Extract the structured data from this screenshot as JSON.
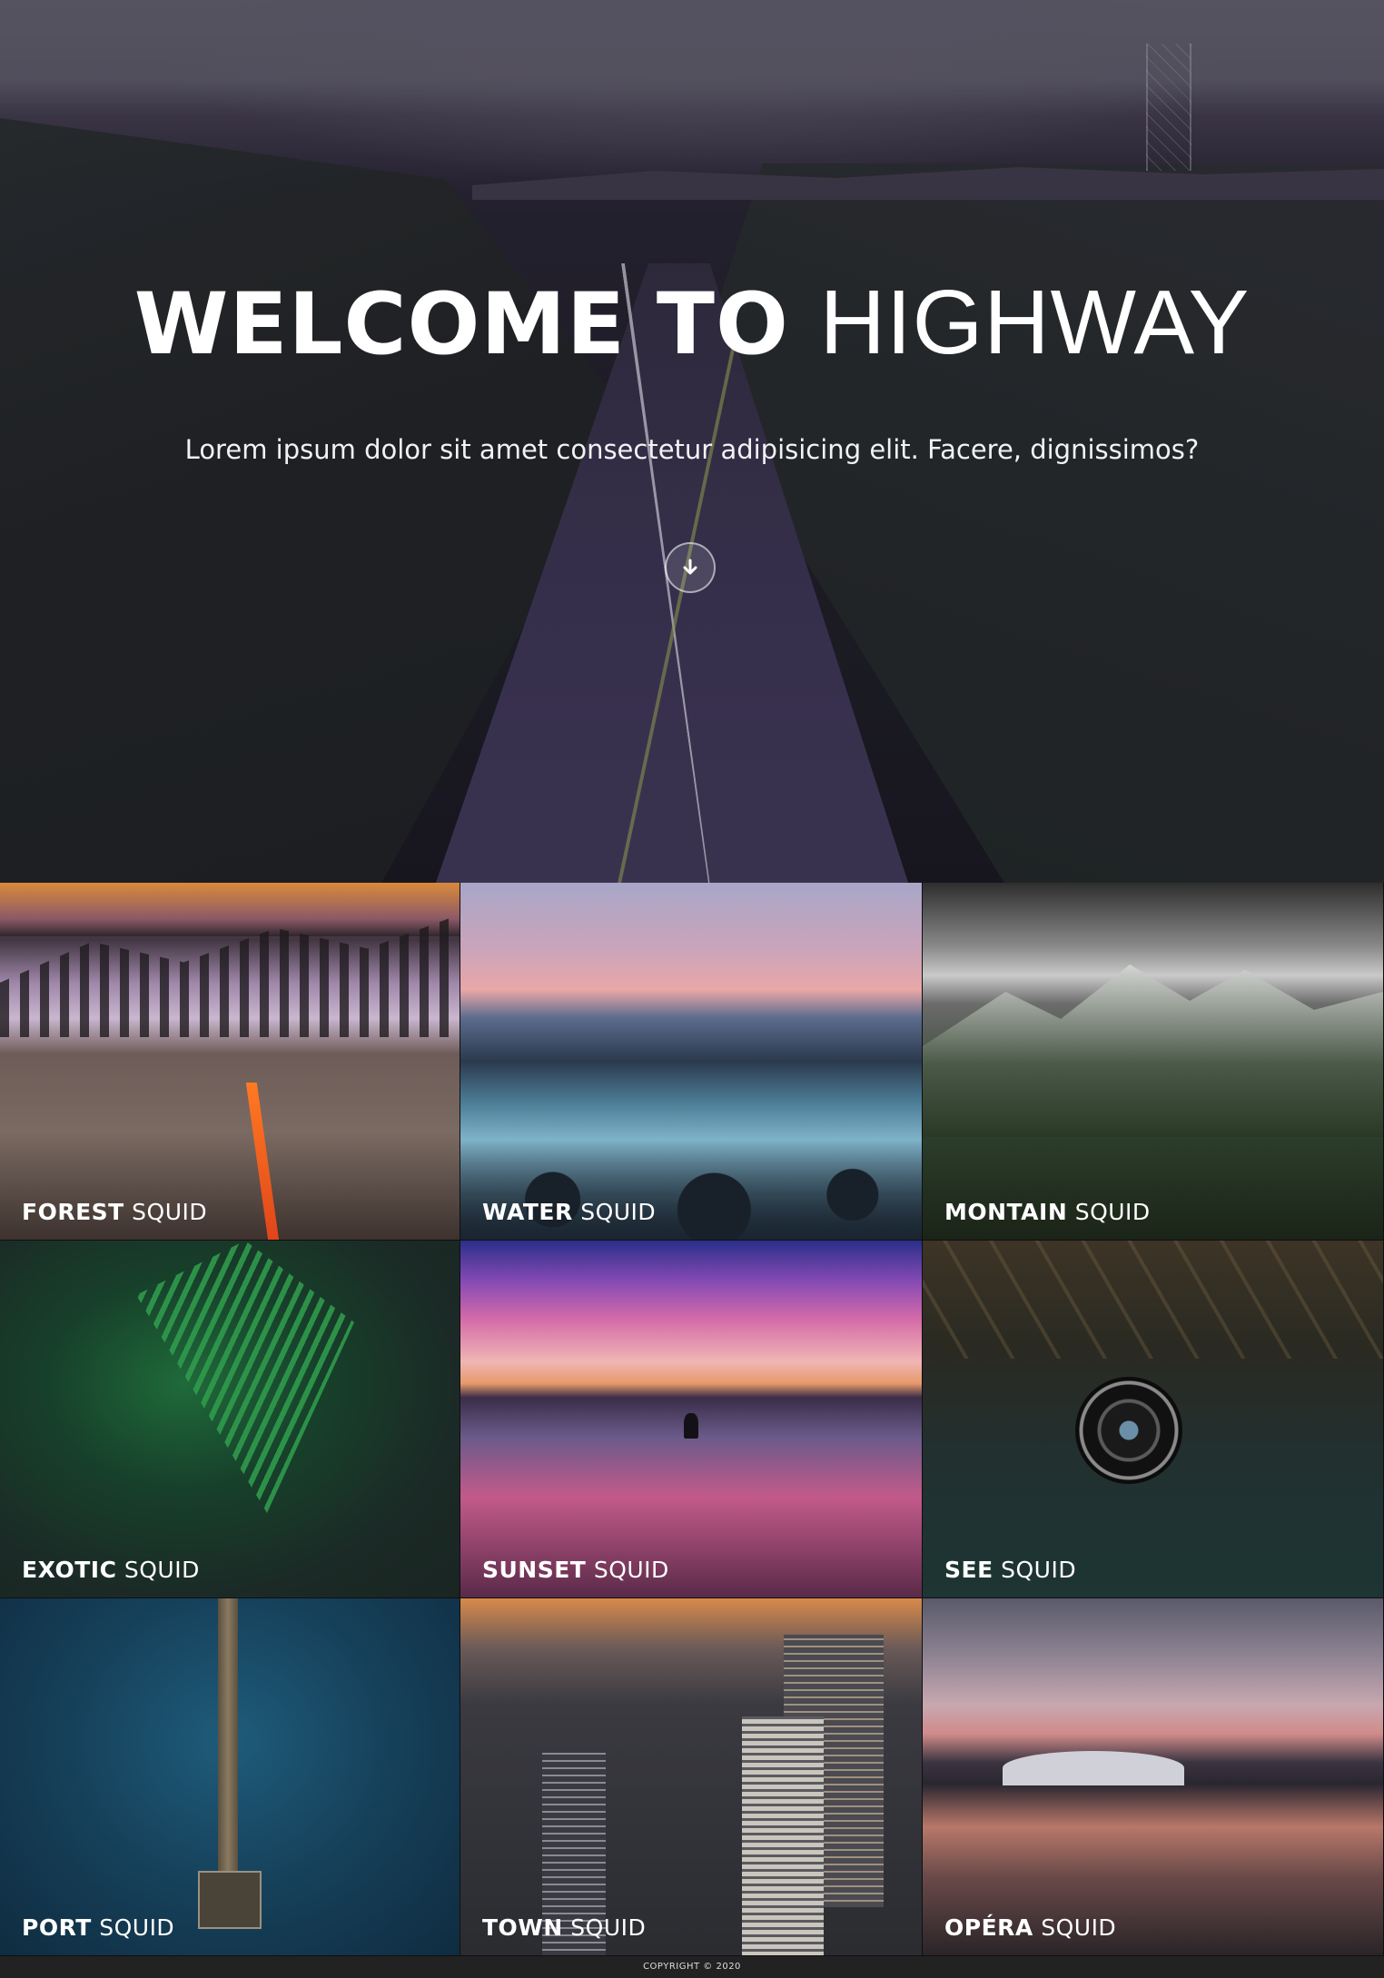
{
  "hero": {
    "title_bold": "WELCOME TO",
    "title_light": "HIGHWAY",
    "subtitle": "Lorem ipsum dolor sit amet consectetur adipisicing elit. Facere, dignissimos?",
    "scroll_icon": "arrow-down-icon"
  },
  "gallery": {
    "tiles": [
      {
        "bold": "FOREST",
        "light": "SQUID"
      },
      {
        "bold": "WATER",
        "light": "SQUID"
      },
      {
        "bold": "MONTAIN",
        "light": "SQUID"
      },
      {
        "bold": "EXOTIC",
        "light": "SQUID"
      },
      {
        "bold": "SUNSET",
        "light": "SQUID"
      },
      {
        "bold": "SEE",
        "light": "SQUID"
      },
      {
        "bold": "PORT",
        "light": "SQUID"
      },
      {
        "bold": "TOWN",
        "light": "SQUID"
      },
      {
        "bold": "OPÉRA",
        "light": "SQUID"
      }
    ]
  },
  "footer": {
    "copyright": "COPYRIGHT © 2020"
  }
}
